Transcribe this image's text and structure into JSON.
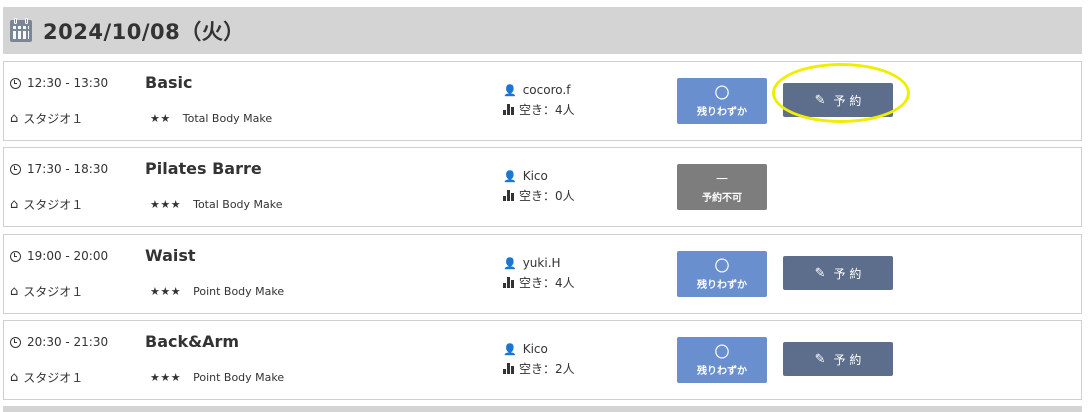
{
  "date_title": "2024/10/08（火）",
  "lessons": [
    {
      "time": "12:30 - 13:30",
      "name": "Basic",
      "studio": "スタジオ１",
      "stars": "★★",
      "program": "Total Body Make",
      "instructor": "cocoro.f",
      "vacancy": "空き：4人",
      "status_mark": "〇",
      "status_text": "残りわずか",
      "reserve_label": "予 約"
    },
    {
      "time": "17:30 - 18:30",
      "name": "Pilates Barre",
      "studio": "スタジオ１",
      "stars": "★★★",
      "program": "Total Body Make",
      "instructor": "Kico",
      "vacancy": "空き：0人",
      "status_mark": "－",
      "status_text": "予約不可"
    },
    {
      "time": "19:00 - 20:00",
      "name": "Waist",
      "studio": "スタジオ１",
      "stars": "★★★",
      "program": "Point Body Make",
      "instructor": "yuki.H",
      "vacancy": "空き：4人",
      "status_mark": "〇",
      "status_text": "残りわずか",
      "reserve_label": "予 約"
    },
    {
      "time": "20:30 - 21:30",
      "name": "Back&Arm",
      "studio": "スタジオ１",
      "stars": "★★★",
      "program": "Point Body Make",
      "instructor": "Kico",
      "vacancy": "空き：2人",
      "status_mark": "〇",
      "status_text": "残りわずか",
      "reserve_label": "予 約"
    }
  ],
  "colors": {
    "header_bg": "#d4d4d4",
    "status_available": "#6a8fcf",
    "status_unavailable": "#7d7d7d",
    "reserve_button": "#5d6e8c",
    "highlight": "#f0ee00"
  }
}
